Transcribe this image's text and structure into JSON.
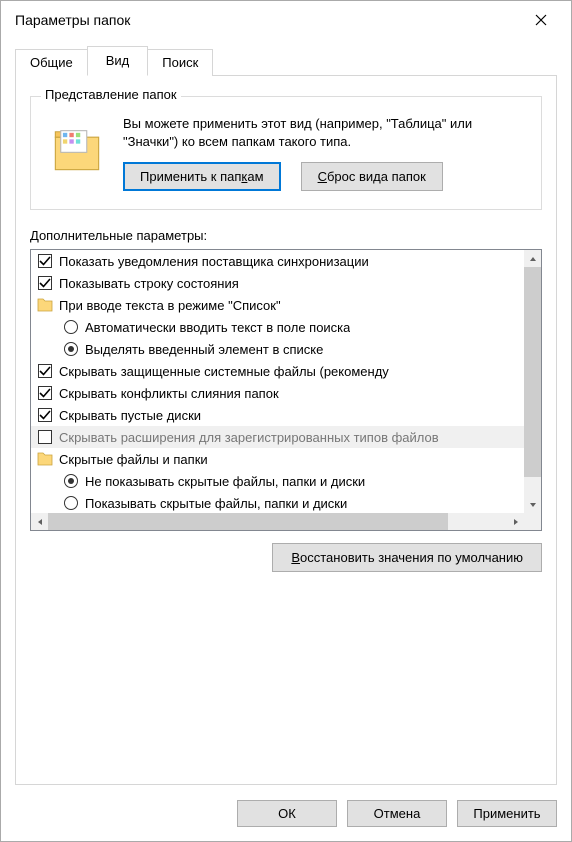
{
  "title": "Параметры папок",
  "tabs": {
    "general": "Общие",
    "view": "Вид",
    "search": "Поиск",
    "active": "view"
  },
  "folderViews": {
    "groupTitle": "Представление папок",
    "description": "Вы можете применить этот вид (например, \"Таблица\" или \"Значки\") ко всем папкам такого типа.",
    "apply_prefix": "Применить к пап",
    "apply_ul": "к",
    "apply_suffix": "ам",
    "reset_ul": "С",
    "reset_suffix": "брос вида папок"
  },
  "advanced": {
    "label": "Дополнительные параметры:",
    "items": [
      {
        "type": "checkbox",
        "checked": true,
        "indent": 1,
        "text": "Показать уведомления поставщика синхронизации"
      },
      {
        "type": "checkbox",
        "checked": true,
        "indent": 1,
        "text": "Показывать строку состояния"
      },
      {
        "type": "folder",
        "indent": 1,
        "text": "При вводе текста в режиме \"Список\""
      },
      {
        "type": "radio",
        "selected": false,
        "indent": 2,
        "text": "Автоматически вводить текст в поле поиска"
      },
      {
        "type": "radio",
        "selected": true,
        "indent": 2,
        "text": "Выделять введенный элемент в списке"
      },
      {
        "type": "checkbox",
        "checked": true,
        "indent": 1,
        "text": "Скрывать защищенные системные файлы (рекоменду"
      },
      {
        "type": "checkbox",
        "checked": true,
        "indent": 1,
        "text": "Скрывать конфликты слияния папок"
      },
      {
        "type": "checkbox",
        "checked": true,
        "indent": 1,
        "text": "Скрывать пустые диски"
      },
      {
        "type": "checkbox",
        "checked": false,
        "indent": 1,
        "highlighted": true,
        "text": "Скрывать расширения для зарегистрированных типов файлов"
      },
      {
        "type": "folder",
        "indent": 1,
        "text": "Скрытые файлы и папки"
      },
      {
        "type": "radio",
        "selected": true,
        "indent": 2,
        "text": "Не показывать скрытые файлы, папки и диски"
      },
      {
        "type": "radio",
        "selected": false,
        "indent": 2,
        "text": "Показывать скрытые файлы, папки и диски"
      }
    ]
  },
  "restore": {
    "ul": "В",
    "suffix": "осстановить значения по умолчанию"
  },
  "footer": {
    "ok": "ОК",
    "cancel": "Отмена",
    "apply": "Применить"
  }
}
